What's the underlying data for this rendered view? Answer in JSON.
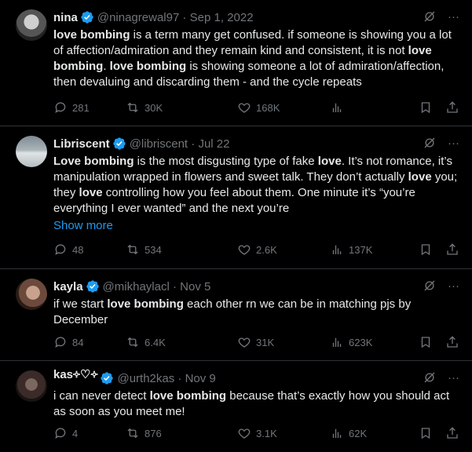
{
  "tweets": [
    {
      "name": "nina",
      "handle": "@ninagrewal97",
      "date": "Sep 1, 2022",
      "body_parts": [
        {
          "b": true,
          "t": "love bombing"
        },
        {
          "b": false,
          "t": " is a term many get confused. if someone is showing you a lot of affection/admiration and they remain kind and consistent, it is not "
        },
        {
          "b": true,
          "t": "love bombing"
        },
        {
          "b": false,
          "t": ". "
        },
        {
          "b": true,
          "t": "love bombing"
        },
        {
          "b": false,
          "t": " is showing someone a lot of admiration/affection, then devaluing and discarding them - and the cycle repeats"
        }
      ],
      "replies": "281",
      "retweets": "30K",
      "likes": "168K",
      "views": ""
    },
    {
      "name": "Libriscent",
      "handle": "@libriscent",
      "date": "Jul 22",
      "body_parts": [
        {
          "b": true,
          "t": "Love bombing"
        },
        {
          "b": false,
          "t": " is the most disgusting type of fake "
        },
        {
          "b": true,
          "t": "love"
        },
        {
          "b": false,
          "t": ". It’s not romance, it’s manipulation wrapped in flowers and sweet talk. They don’t actually "
        },
        {
          "b": true,
          "t": "love"
        },
        {
          "b": false,
          "t": " you; they "
        },
        {
          "b": true,
          "t": "love"
        },
        {
          "b": false,
          "t": " controlling how you feel about them. One minute it’s “you’re everything I ever wanted” and the next you’re"
        }
      ],
      "show_more": "Show more",
      "replies": "48",
      "retweets": "534",
      "likes": "2.6K",
      "views": "137K"
    },
    {
      "name": "kayla",
      "handle": "@mikhaylacl",
      "date": "Nov 5",
      "body_parts": [
        {
          "b": false,
          "t": "if we start "
        },
        {
          "b": true,
          "t": "love bombing"
        },
        {
          "b": false,
          "t": " each other rn we can be in matching pjs by December"
        }
      ],
      "replies": "84",
      "retweets": "6.4K",
      "likes": "31K",
      "views": "623K"
    },
    {
      "name": "kas༓♡༓",
      "handle": "@urth2kas",
      "date": "Nov 9",
      "body_parts": [
        {
          "b": false,
          "t": "i can never detect "
        },
        {
          "b": true,
          "t": "love bombing"
        },
        {
          "b": false,
          "t": " because that’s exactly how you should act as soon as you meet me!"
        }
      ],
      "replies": "4",
      "retweets": "876",
      "likes": "3.1K",
      "views": "62K"
    }
  ],
  "sep": "·",
  "more": "···",
  "colors": {
    "bg": "#000000",
    "text": "#e7e9ea",
    "muted": "#71767b",
    "link": "#1d9bf0",
    "border": "#2f3336",
    "verified": "#1d9bf0"
  },
  "icons": [
    "verified-badge-icon",
    "grok-icon",
    "more-icon",
    "reply-icon",
    "retweet-icon",
    "like-icon",
    "views-icon",
    "bookmark-icon",
    "share-icon"
  ]
}
